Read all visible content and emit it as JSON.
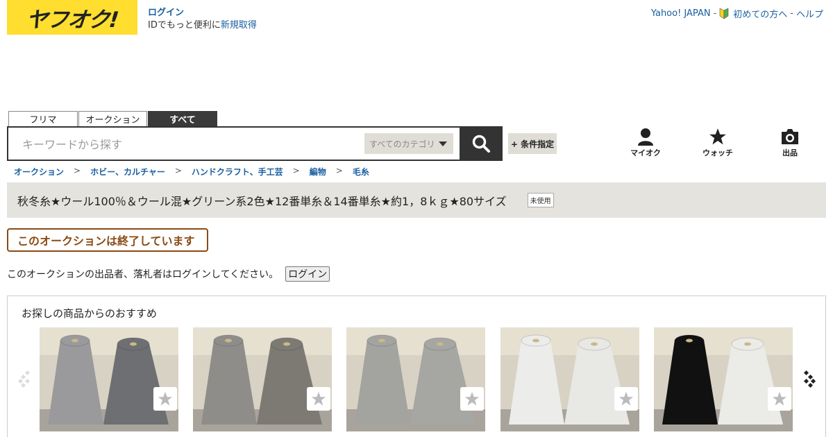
{
  "header": {
    "logo_text": "ヤフオク!",
    "login_label": "ログイン",
    "login_sub_text": "IDでもっと便利に",
    "register_link": "新規取得",
    "top_links": {
      "yahoo_japan": "Yahoo! JAPAN",
      "beginners": "初めての方へ",
      "help": "ヘルプ",
      "separator": "-"
    }
  },
  "search": {
    "tabs": [
      "フリマ",
      "オークション",
      "すべて"
    ],
    "active_tab": "すべて",
    "placeholder": "キーワードから探す",
    "category_selected": "すべてのカテゴリ",
    "condition_button": "+ 条件指定"
  },
  "nav": {
    "my_auction": "マイオク",
    "watch": "ウォッチ",
    "sell": "出品"
  },
  "breadcrumb": {
    "items": [
      "オークション",
      "ホビー、カルチャー",
      "ハンドクラフト、手工芸",
      "編物",
      "毛糸"
    ],
    "separator": ">"
  },
  "item": {
    "title": "秋冬糸★ウール100％＆ウール混★グリーン系2色★12番単糸＆14番単糸★約1，8ｋｇ★80サイズ",
    "condition_badge": "未使用"
  },
  "ended_notice": "このオークションは終了しています",
  "login_notice": {
    "text": "このオークションの出品者、落札者はログインしてください。",
    "button": "ログイン"
  },
  "recommendations": {
    "title": "お探しの商品からのおすすめ",
    "items": [
      {
        "left_color": "#9a9a9c",
        "right_color": "#6e6f72"
      },
      {
        "left_color": "#8f8d8a",
        "right_color": "#7d7a74"
      },
      {
        "left_color": "#a3a39f",
        "right_color": "#a6a6a2"
      },
      {
        "left_color": "#ececea",
        "right_color": "#e8e8e4"
      },
      {
        "left_color": "#111111",
        "right_color": "#ebebe8"
      }
    ]
  },
  "colors": {
    "brand_yellow": "#ffde2f",
    "link_blue": "#1a5fa0",
    "ended_brown": "#8a4a12"
  }
}
